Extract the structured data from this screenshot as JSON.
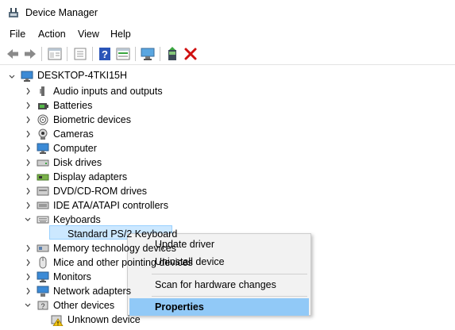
{
  "window": {
    "title": "Device Manager"
  },
  "menu": [
    "File",
    "Action",
    "View",
    "Help"
  ],
  "toolbar": {
    "buttons": [
      "back-icon",
      "forward-icon",
      "properties-icon",
      "update-driver-icon",
      "help-icon",
      "view-icon",
      "scan-hardware-icon",
      "add-driver-icon",
      "uninstall-icon"
    ]
  },
  "tree": {
    "root": "DESKTOP-4TKI15H",
    "items": [
      {
        "label": "Audio inputs and outputs",
        "icon": "speaker-icon"
      },
      {
        "label": "Batteries",
        "icon": "battery-icon"
      },
      {
        "label": "Biometric devices",
        "icon": "fingerprint-icon"
      },
      {
        "label": "Cameras",
        "icon": "camera-icon"
      },
      {
        "label": "Computer",
        "icon": "computer-icon"
      },
      {
        "label": "Disk drives",
        "icon": "disk-drive-icon"
      },
      {
        "label": "Display adapters",
        "icon": "display-adapter-icon"
      },
      {
        "label": "DVD/CD-ROM drives",
        "icon": "dvd-drive-icon"
      },
      {
        "label": "IDE ATA/ATAPI controllers",
        "icon": "ide-controller-icon"
      },
      {
        "label": "Keyboards",
        "icon": "keyboard-icon"
      },
      {
        "label": "Standard PS/2 Keyboard",
        "icon": "keyboard-icon"
      },
      {
        "label": "Memory technology devices",
        "icon": "memory-icon"
      },
      {
        "label": "Mice and other pointing devices",
        "icon": "mouse-icon"
      },
      {
        "label": "Monitors",
        "icon": "monitor-icon"
      },
      {
        "label": "Network adapters",
        "icon": "network-icon"
      },
      {
        "label": "Other devices",
        "icon": "other-devices-icon"
      },
      {
        "label": "Unknown device",
        "icon": "warning-device-icon"
      }
    ]
  },
  "context_menu": {
    "items": [
      "Update driver",
      "Uninstall device",
      "Scan for hardware changes",
      "Properties"
    ]
  },
  "colors": {
    "selection": "#cce8ff",
    "menu_highlight": "#91c9f7",
    "uninstall_red": "#d01010"
  }
}
